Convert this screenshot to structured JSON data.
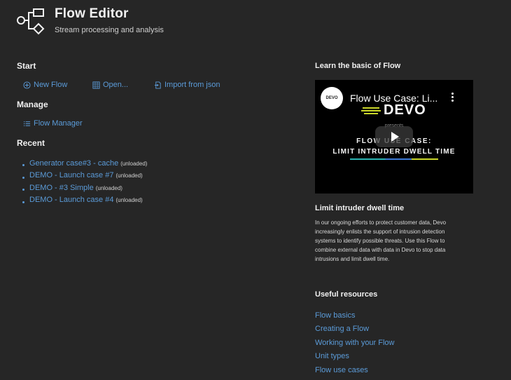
{
  "header": {
    "title": "Flow Editor",
    "subtitle": "Stream processing and analysis",
    "logo_icon": "flow-diagram-icon"
  },
  "start": {
    "title": "Start",
    "new_flow": "New Flow",
    "open": "Open...",
    "import": "Import from json"
  },
  "manage": {
    "title": "Manage",
    "flow_manager": "Flow Manager"
  },
  "recent": {
    "title": "Recent",
    "items": [
      {
        "name": "Generator case#3 - cache",
        "status": "(unloaded)"
      },
      {
        "name": "DEMO - Launch case #7",
        "status": "(unloaded)"
      },
      {
        "name": "DEMO - #3 Simple",
        "status": "(unloaded)"
      },
      {
        "name": "DEMO - Launch case #4",
        "status": "(unloaded)"
      }
    ]
  },
  "learn": {
    "title": "Learn the basic of Flow",
    "video": {
      "channel": "DEVO",
      "title": "Flow Use Case: Li...",
      "brand": "DEVO",
      "presents": "presents",
      "line1": "FLOW USE CASE:",
      "line2": "LIMIT INTRUDER DWELL TIME"
    },
    "heading": "Limit intruder dwell time",
    "description": "In our ongoing efforts to protect customer data, Devo increasingly enlists the support of intrusion detection systems to identify possible threats. Use this Flow to combine external data with data in Devo to stop data intrusions and limit dwell time."
  },
  "resources": {
    "title": "Useful resources",
    "links": [
      "Flow basics",
      "Creating a Flow",
      "Working with your Flow",
      "Unit types",
      "Flow use cases"
    ]
  },
  "colors": {
    "background": "#262626",
    "link": "#5b9bd8"
  }
}
